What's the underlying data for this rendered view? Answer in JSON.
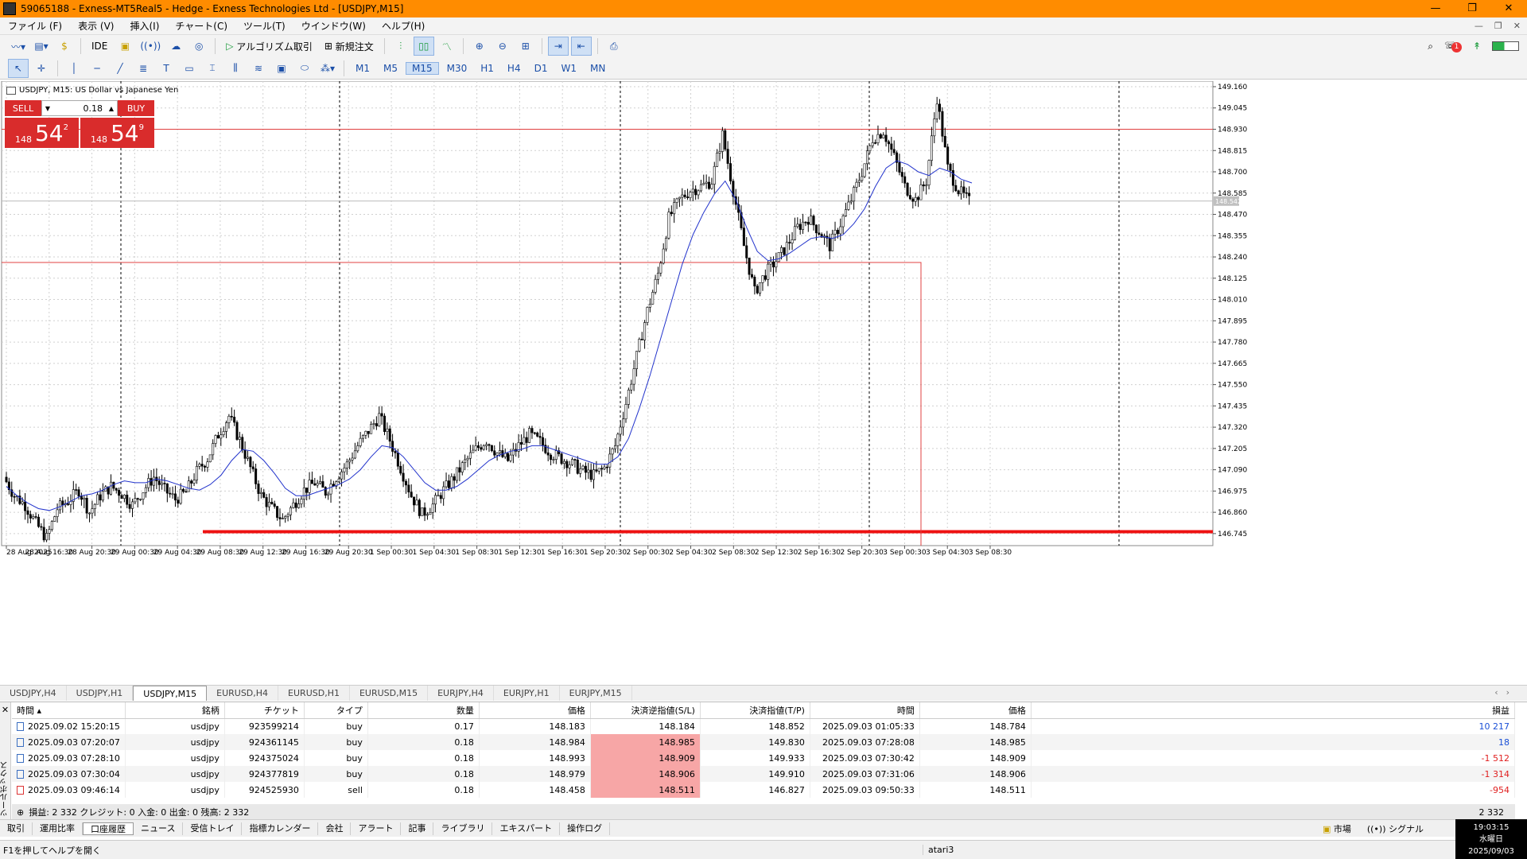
{
  "titlebar": {
    "title": "59065188 - Exness-MT5Real5 - Hedge - Exness Technologies Ltd - [USDJPY,M15]"
  },
  "menu": [
    "ファイル (F)",
    "表示 (V)",
    "挿入(I)",
    "チャート(C)",
    "ツール(T)",
    "ウインドウ(W)",
    "ヘルプ(H)"
  ],
  "toolbar": {
    "ide": "IDE",
    "algo": "アルゴリズム取引",
    "neworder": "新規注文",
    "notif_count": "1"
  },
  "timeframes": [
    "M1",
    "M5",
    "M15",
    "M30",
    "H1",
    "H4",
    "D1",
    "W1",
    "MN"
  ],
  "chart": {
    "title": "USDJPY, M15:  US Dollar vs Japanese Yen",
    "sell_label": "SELL",
    "buy_label": "BUY",
    "lot": "0.18",
    "bid_small": "148",
    "bid_big": "54",
    "bid_sup": "2",
    "ask_small": "148",
    "ask_big": "54",
    "ask_sup": "9",
    "current_price_label": "148.542"
  },
  "chart_data": {
    "type": "candlestick",
    "symbol": "USDJPY",
    "timeframe": "M15",
    "y_ticks": [
      "149.160",
      "149.045",
      "148.930",
      "148.815",
      "148.700",
      "148.585",
      "148.470",
      "148.355",
      "148.240",
      "148.125",
      "148.010",
      "147.895",
      "147.780",
      "147.665",
      "147.550",
      "147.435",
      "147.320",
      "147.205",
      "147.090",
      "146.975",
      "146.860",
      "146.745"
    ],
    "x_ticks": [
      "28 Aug 2025",
      "28 Aug 16:30",
      "28 Aug 20:30",
      "29 Aug 00:30",
      "29 Aug 04:30",
      "29 Aug 08:30",
      "29 Aug 12:30",
      "29 Aug 16:30",
      "29 Aug 20:30",
      "1 Sep 00:30",
      "1 Sep 04:30",
      "1 Sep 08:30",
      "1 Sep 12:30",
      "1 Sep 16:30",
      "1 Sep 20:30",
      "2 Sep 00:30",
      "2 Sep 04:30",
      "2 Sep 08:30",
      "2 Sep 12:30",
      "2 Sep 16:30",
      "2 Sep 20:30",
      "3 Sep 00:30",
      "3 Sep 04:30",
      "3 Sep 08:30"
    ],
    "ylim": [
      146.68,
      149.19
    ],
    "price_path": [
      147.05,
      146.95,
      146.9,
      146.8,
      146.72,
      146.88,
      146.92,
      146.98,
      146.86,
      146.95,
      147.0,
      146.96,
      146.9,
      146.98,
      147.05,
      146.98,
      146.93,
      146.97,
      147.08,
      147.15,
      147.28,
      147.38,
      147.25,
      147.1,
      146.95,
      146.88,
      146.82,
      146.9,
      146.98,
      147.02,
      146.97,
      147.05,
      147.12,
      147.22,
      147.3,
      147.38,
      147.25,
      147.1,
      146.95,
      146.85,
      146.9,
      146.98,
      147.05,
      147.13,
      147.2,
      147.25,
      147.18,
      147.14,
      147.22,
      147.28,
      147.24,
      147.18,
      147.15,
      147.12,
      147.08,
      147.06,
      147.1,
      147.22,
      147.45,
      147.7,
      147.95,
      148.15,
      148.45,
      148.55,
      148.6,
      148.62,
      148.65,
      148.9,
      148.6,
      148.3,
      148.05,
      148.15,
      148.22,
      148.3,
      148.4,
      148.45,
      148.38,
      148.3,
      148.42,
      148.55,
      148.7,
      148.88,
      148.92,
      148.78,
      148.62,
      148.55,
      148.65,
      149.1,
      148.72,
      148.6,
      148.54
    ],
    "ma_path": [
      147.0,
      146.95,
      146.91,
      146.88,
      146.87,
      146.89,
      146.92,
      146.95,
      146.96,
      146.98,
      147.01,
      147.03,
      147.02,
      147.02,
      147.04,
      147.03,
      147.01,
      146.99,
      146.98,
      147.01,
      147.06,
      147.14,
      147.2,
      147.19,
      147.14,
      147.07,
      146.99,
      146.95,
      146.95,
      146.97,
      146.99,
      147.01,
      147.04,
      147.09,
      147.16,
      147.22,
      147.21,
      147.16,
      147.09,
      147.02,
      146.98,
      146.98,
      147.0,
      147.04,
      147.09,
      147.14,
      147.17,
      147.19,
      147.2,
      147.22,
      147.22,
      147.2,
      147.18,
      147.16,
      147.14,
      147.12,
      147.12,
      147.16,
      147.26,
      147.42,
      147.6,
      147.8,
      148.0,
      148.2,
      148.36,
      148.48,
      148.58,
      148.65,
      148.55,
      148.4,
      148.27,
      148.22,
      148.23,
      148.26,
      148.3,
      148.34,
      148.35,
      148.34,
      148.36,
      148.42,
      148.5,
      148.62,
      148.72,
      148.76,
      148.74,
      148.7,
      148.68,
      148.72,
      148.7,
      148.66,
      148.64
    ],
    "hlines": [
      {
        "price": 148.93,
        "color": "#e04040",
        "note": "tp"
      },
      {
        "price": 146.755,
        "color": "#ee1111",
        "note": "sl"
      },
      {
        "price": 148.542,
        "color": "#bbbbbb",
        "note": "current"
      }
    ],
    "box": {
      "price": 148.21,
      "color": "#e04040"
    },
    "grid": true
  },
  "symbol_tabs": [
    "USDJPY,H4",
    "USDJPY,H1",
    "USDJPY,M15",
    "EURUSD,H4",
    "EURUSD,H1",
    "EURUSD,M15",
    "EURJPY,H4",
    "EURJPY,H1",
    "EURJPY,M15"
  ],
  "active_symbol_tab": "USDJPY,M15",
  "history": {
    "headers": [
      "時間",
      "銘柄",
      "チケット",
      "タイプ",
      "数量",
      "価格",
      "決済逆指値(S/L)",
      "決済指値(T/P)",
      "時間",
      "価格",
      "損益"
    ],
    "rows": [
      {
        "time": "2025.09.02 15:20:15",
        "symbol": "usdjpy",
        "ticket": "923599214",
        "type": "buy",
        "volume": "0.17",
        "price": "148.183",
        "sl": "148.184",
        "tp": "148.852",
        "close_time": "2025.09.03 01:05:33",
        "close_price": "148.784",
        "profit": "10 217",
        "sl_hl": false,
        "positive": true
      },
      {
        "time": "2025.09.03 07:20:07",
        "symbol": "usdjpy",
        "ticket": "924361145",
        "type": "buy",
        "volume": "0.18",
        "price": "148.984",
        "sl": "148.985",
        "tp": "149.830",
        "close_time": "2025.09.03 07:28:08",
        "close_price": "148.985",
        "profit": "18",
        "sl_hl": true,
        "positive": true
      },
      {
        "time": "2025.09.03 07:28:10",
        "symbol": "usdjpy",
        "ticket": "924375024",
        "type": "buy",
        "volume": "0.18",
        "price": "148.993",
        "sl": "148.909",
        "tp": "149.933",
        "close_time": "2025.09.03 07:30:42",
        "close_price": "148.909",
        "profit": "-1 512",
        "sl_hl": true,
        "positive": false
      },
      {
        "time": "2025.09.03 07:30:04",
        "symbol": "usdjpy",
        "ticket": "924377819",
        "type": "buy",
        "volume": "0.18",
        "price": "148.979",
        "sl": "148.906",
        "tp": "149.910",
        "close_time": "2025.09.03 07:31:06",
        "close_price": "148.906",
        "profit": "-1 314",
        "sl_hl": true,
        "positive": false
      },
      {
        "time": "2025.09.03 09:46:14",
        "symbol": "usdjpy",
        "ticket": "924525930",
        "type": "sell",
        "volume": "0.18",
        "price": "148.458",
        "sl": "148.511",
        "tp": "146.827",
        "close_time": "2025.09.03 09:50:33",
        "close_price": "148.511",
        "profit": "-954",
        "sl_hl": true,
        "positive": false
      }
    ],
    "summary": "損益: 2 332  クレジット: 0  入金: 0  出金: 0  残高: 2 332",
    "summary_total": "2 332"
  },
  "bottom_tabs": [
    "取引",
    "運用比率",
    "口座履歴",
    "ニュース",
    "受信トレイ",
    "指標カレンダー",
    "会社",
    "アラート",
    "記事",
    "ライブラリ",
    "エキスパート",
    "操作ログ"
  ],
  "active_bottom_tab": "口座履歴",
  "bottom_right": {
    "market": "市場",
    "signal": "シグナル"
  },
  "toolbox_label": "ツールボックス",
  "status": {
    "help": "F1を押してヘルプを開く",
    "profile": "atari3"
  },
  "clock": {
    "time": "19:03:15",
    "day": "水曜日",
    "date": "2025/09/03"
  },
  "colors": {
    "titlebar": "#ff8c00",
    "candle": "#000000",
    "ma": "#2233cc",
    "trade_red": "#d92c2c",
    "profit_pos": "#1a4fd6",
    "profit_neg": "#e02020"
  }
}
